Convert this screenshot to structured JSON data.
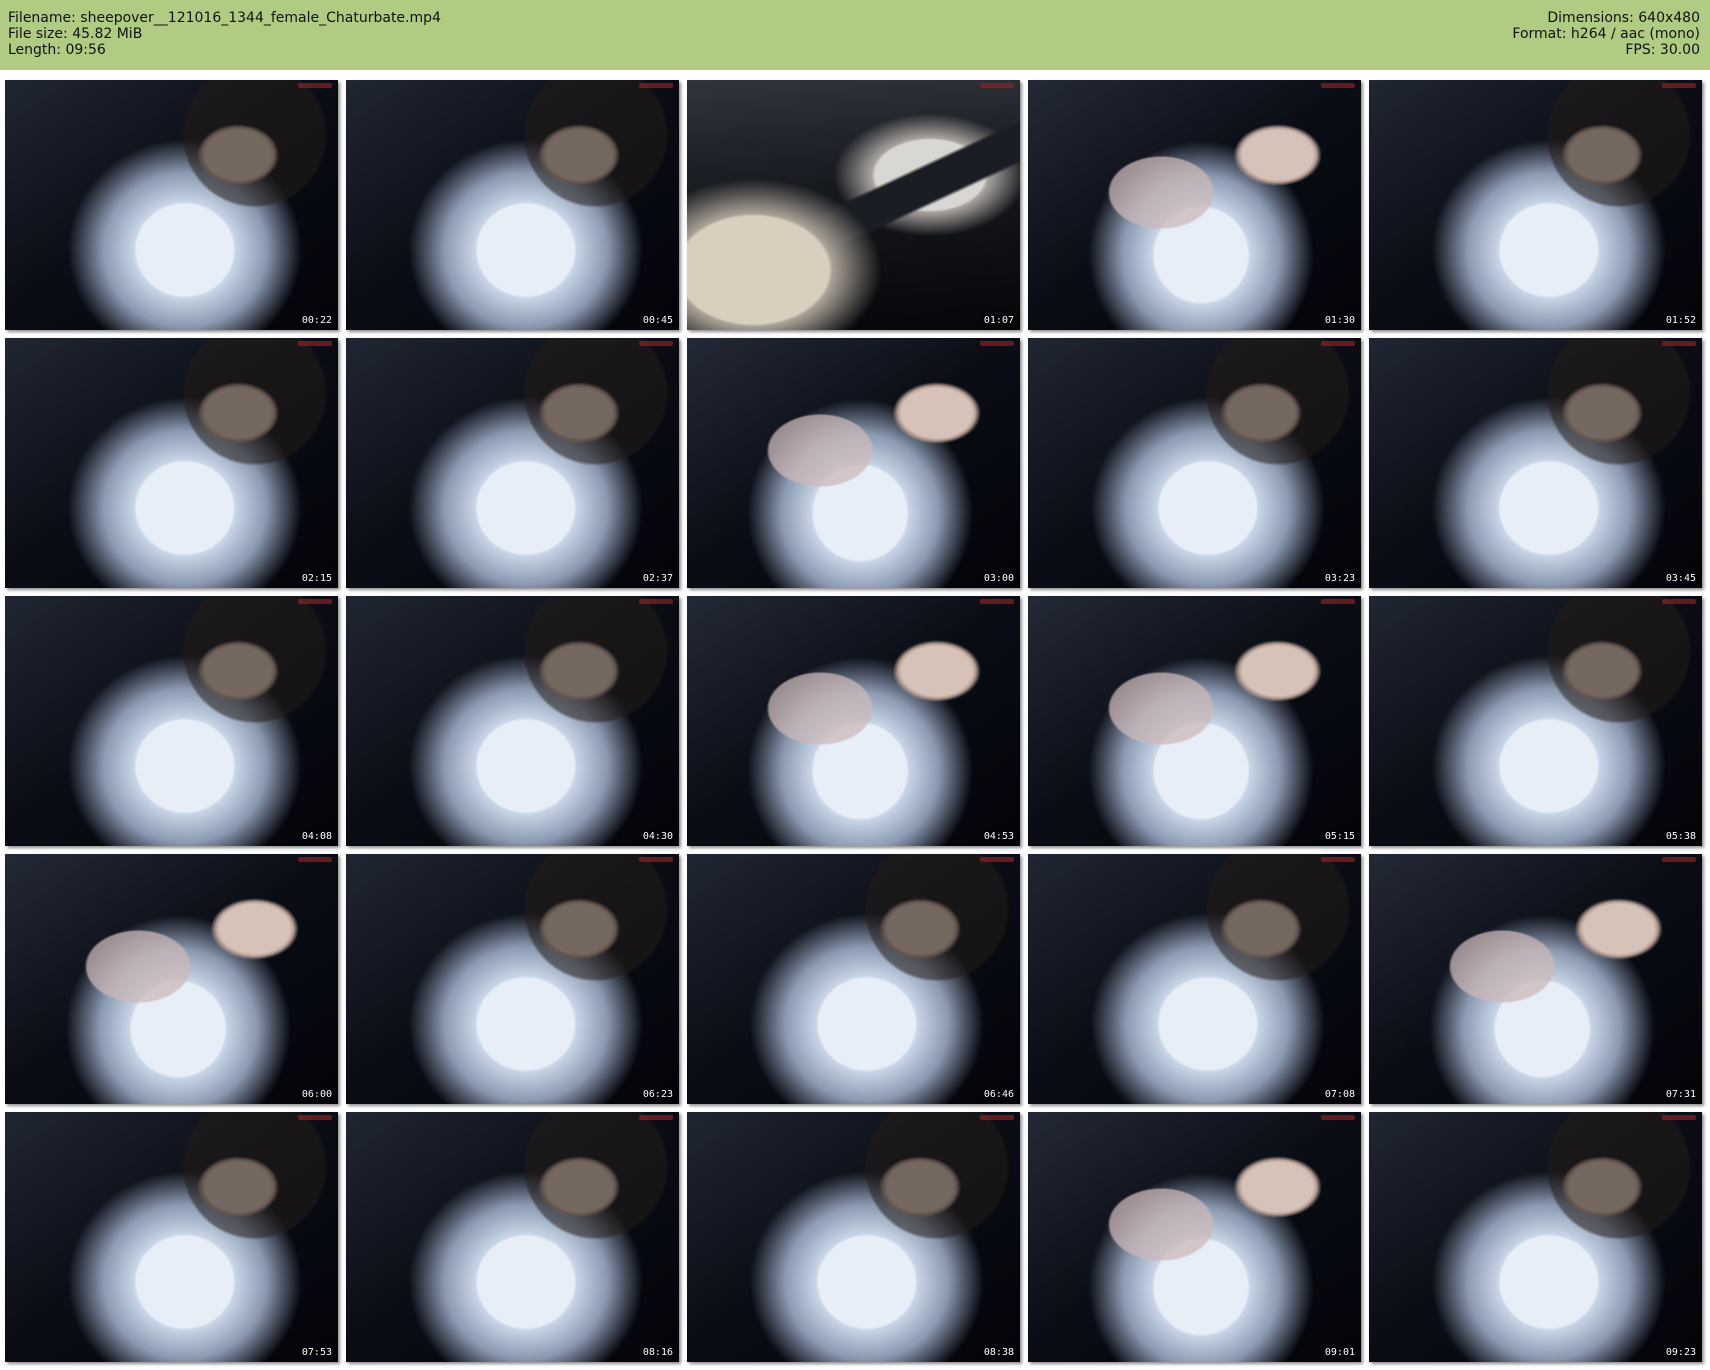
{
  "header": {
    "filename": "Filename: sheepover__121016_1344_female_Chaturbate.mp4",
    "file_size": "File size: 45.82 MiB",
    "length": "Length: 09:56",
    "dimensions": "Dimensions: 640x480",
    "format": "Format: h264 / aac (mono)",
    "fps": "FPS: 30.00"
  },
  "colors": {
    "header_background": "#b0cc83",
    "page_background": "#ffffff"
  },
  "thumbnails": [
    {
      "timestamp": "00:22"
    },
    {
      "timestamp": "00:45"
    },
    {
      "timestamp": "01:07"
    },
    {
      "timestamp": "01:30"
    },
    {
      "timestamp": "01:52"
    },
    {
      "timestamp": "02:15"
    },
    {
      "timestamp": "02:37"
    },
    {
      "timestamp": "03:00"
    },
    {
      "timestamp": "03:23"
    },
    {
      "timestamp": "03:45"
    },
    {
      "timestamp": "04:08"
    },
    {
      "timestamp": "04:30"
    },
    {
      "timestamp": "04:53"
    },
    {
      "timestamp": "05:15"
    },
    {
      "timestamp": "05:38"
    },
    {
      "timestamp": "06:00"
    },
    {
      "timestamp": "06:23"
    },
    {
      "timestamp": "06:46"
    },
    {
      "timestamp": "07:08"
    },
    {
      "timestamp": "07:31"
    },
    {
      "timestamp": "07:53"
    },
    {
      "timestamp": "08:16"
    },
    {
      "timestamp": "08:38"
    },
    {
      "timestamp": "09:01"
    },
    {
      "timestamp": "09:23"
    }
  ]
}
